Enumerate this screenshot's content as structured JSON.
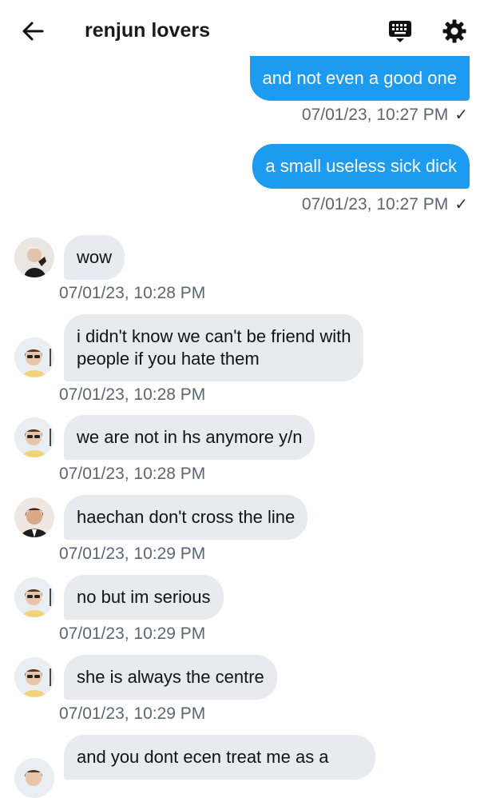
{
  "header": {
    "title": "renjun lovers",
    "back_icon": "arrow-left-icon",
    "keyboard_icon": "keyboard-icon",
    "settings_icon": "gear-icon"
  },
  "messages": [
    {
      "dir": "out",
      "text": "and not even a good one",
      "time": "07/01/23, 10:27 PM",
      "status": "✓"
    },
    {
      "dir": "out",
      "text": "a small useless sick dick",
      "time": "07/01/23, 10:27 PM",
      "status": "✓"
    },
    {
      "dir": "in",
      "text": "wow",
      "time": "07/01/23, 10:28 PM",
      "avatar": "dark"
    },
    {
      "dir": "in",
      "lines": [
        "i didn't know we can't be friend with",
        "people if you hate them"
      ],
      "time": "07/01/23, 10:28 PM",
      "avatar": "glasses"
    },
    {
      "dir": "in",
      "text": "we are not in hs anymore y/n",
      "time": "07/01/23, 10:28 PM",
      "avatar": "glasses"
    },
    {
      "dir": "in",
      "text": "haechan don't cross the line",
      "time": "07/01/23, 10:29 PM",
      "avatar": "brown"
    },
    {
      "dir": "in",
      "text": "no but im serious",
      "time": "07/01/23, 10:29 PM",
      "avatar": "glasses"
    },
    {
      "dir": "in",
      "text": "she is always the centre",
      "time": "07/01/23, 10:29 PM",
      "avatar": "glasses"
    },
    {
      "dir": "in",
      "text": "and you dont ecen treat me as a",
      "time": "",
      "avatar": "glasses"
    }
  ],
  "colors": {
    "outgoing_bubble": "#1d9bf0",
    "incoming_bubble": "#e7ebef",
    "meta_text": "#5b6670"
  }
}
